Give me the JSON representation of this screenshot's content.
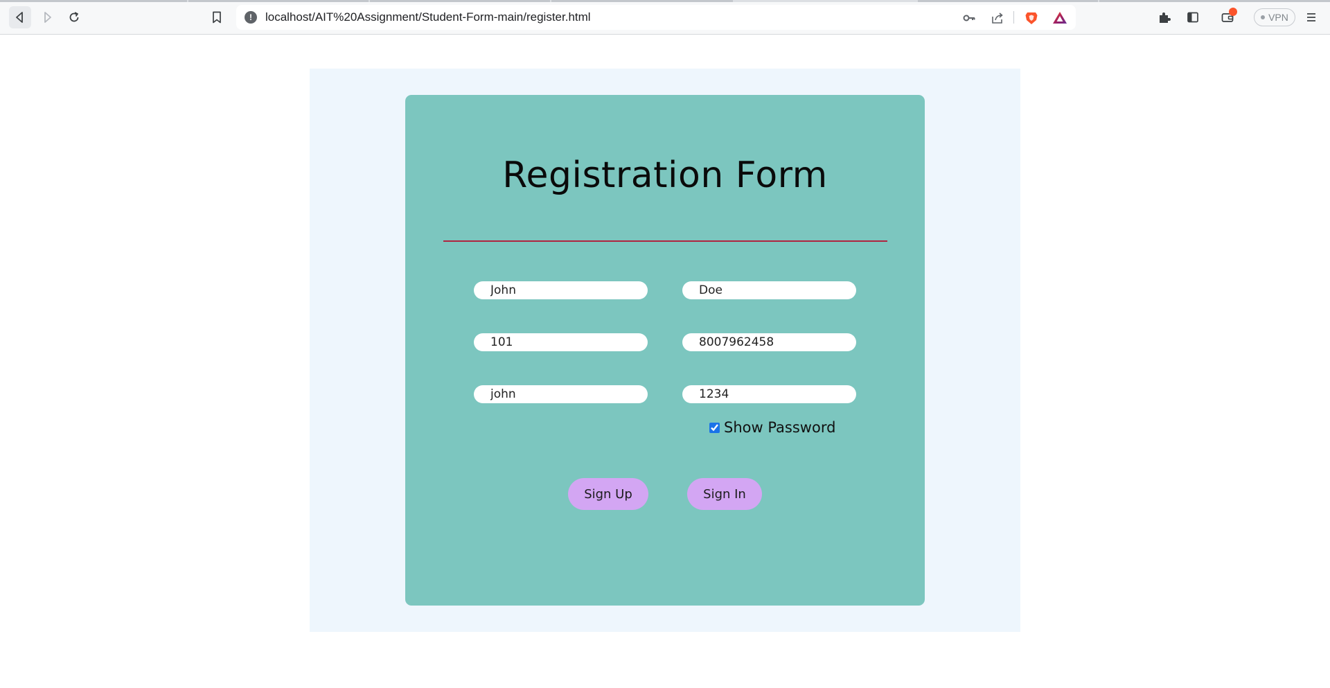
{
  "browser": {
    "url": "localhost/AIT%20Assignment/Student-Form-main/register.html",
    "vpn_label": "VPN",
    "icons": {
      "back": "back-arrow-icon",
      "forward": "forward-arrow-icon",
      "reload": "reload-icon",
      "bookmark": "bookmark-icon",
      "site_info": "info-icon",
      "key": "key-icon",
      "share": "share-icon",
      "brave": "brave-lion-icon",
      "rewards": "brave-rewards-triangle-icon",
      "extensions": "puzzle-icon",
      "sidebar": "sidebar-icon",
      "wallet": "wallet-icon",
      "menu": "hamburger-menu-icon"
    },
    "info_glyph": "!"
  },
  "form": {
    "title": "Registration Form",
    "fields": {
      "first_name": "John",
      "last_name": "Doe",
      "id": "101",
      "phone": "8007962458",
      "username": "john",
      "password": "1234"
    },
    "show_password_label": "Show Password",
    "show_password_checked": true,
    "signup_label": "Sign Up",
    "signin_label": "Sign In"
  },
  "colors": {
    "page_background": "#eef6fd",
    "card": "#7cc6bf",
    "divider": "#b0243f",
    "button": "#d3a6f3",
    "notification": "#fb542b"
  }
}
